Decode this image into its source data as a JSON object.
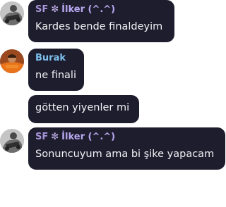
{
  "messages": [
    {
      "sender": {
        "prefix": "SF",
        "star": "✼",
        "name": "İlker (^.^)"
      },
      "text": "Kardes bende finaldeyim",
      "avatar": "avatar-grey-rider"
    },
    {
      "sender": {
        "name": "Burak"
      },
      "text": "ne finali",
      "avatar": "avatar-orange-player"
    },
    {
      "text": "götten yiyenler mi"
    },
    {
      "sender": {
        "prefix": "SF",
        "star": "✼",
        "name": "İlker (^.^)"
      },
      "text": "Sonuncuyum ama bi şike yapacam",
      "avatar": "avatar-grey-rider"
    }
  ],
  "colors": {
    "bubble": "#1e1d2e",
    "text": "#f2f2f5",
    "ilker_name": "#b9a8f0",
    "burak_name": "#7cc0ee"
  }
}
